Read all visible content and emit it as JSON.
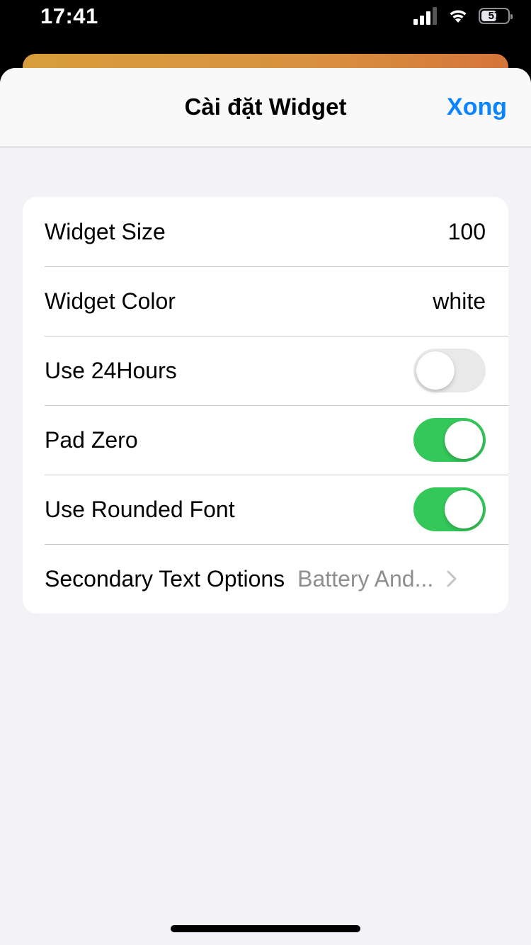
{
  "status": {
    "time": "17:41",
    "battery": "57",
    "battery_level": 0.57
  },
  "nav": {
    "title": "Cài đặt Widget",
    "done": "Xong"
  },
  "settings": [
    {
      "label": "Widget Size",
      "type": "value",
      "value": "100"
    },
    {
      "label": "Widget Color",
      "type": "value",
      "value": "white"
    },
    {
      "label": "Use 24Hours",
      "type": "toggle",
      "on": false
    },
    {
      "label": "Pad Zero",
      "type": "toggle",
      "on": true
    },
    {
      "label": "Use Rounded Font",
      "type": "toggle",
      "on": true
    },
    {
      "label": "Secondary Text Options",
      "type": "disclosure",
      "value": "Battery And..."
    }
  ],
  "colors": {
    "accent": "#0a84ff",
    "toggle_on": "#34c759",
    "toggle_off": "#e9e9ea",
    "background": "#f2f2f7",
    "header_card": "#d8913f"
  },
  "icons": [
    "cellular-signal-icon",
    "wifi-icon",
    "battery-icon",
    "chevron-right-icon"
  ]
}
